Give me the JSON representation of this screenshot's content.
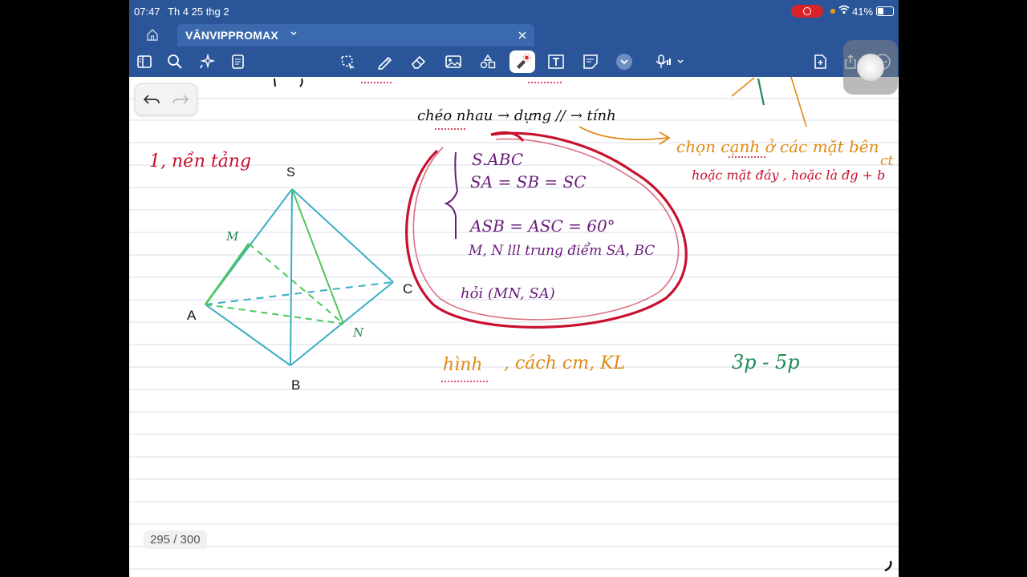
{
  "status_bar": {
    "time": "07:47",
    "date": "Th 4 25 thg 2",
    "battery": "41%"
  },
  "tab": {
    "title": "VÂNVIPPROMAX"
  },
  "page_indicator": "295 / 300",
  "notes": {
    "line_cheo": "chéo nhau → dựng // → tính",
    "chon_canh": "chọn cạnh ở các mặt bên",
    "hoac_mat": "hoặc mặt đáy , hoặc là đg + b",
    "ct": "ct",
    "nen_tang": "1, nền tảng",
    "s_abc": "S.ABC",
    "sa_sb_sc": "SA = SB = SC",
    "angles": "ASB = ASC = 60°",
    "mn": "M, N lll trung điểm SA, BC",
    "hoi": "hỏi (MN, SA)",
    "hinh": "hình",
    "cach_cm": ", cách cm, KL",
    "time_est": "3p - 5p",
    "label_S": "S",
    "label_A": "A",
    "label_B": "B",
    "label_C": "C",
    "label_M": "M",
    "label_N": "N"
  },
  "colors": {
    "brand": "#2a5699",
    "tab": "#3b69ad",
    "pen_red": "#c8102e",
    "pen_purple": "#6a1b7a",
    "pen_orange": "#e08a12",
    "pen_green": "#1f8a52",
    "pen_teal": "#3aaec4",
    "pen_lime": "#4cc75a"
  },
  "icons": [
    "home-icon",
    "sidebar-icon",
    "search-icon",
    "sparkle-icon",
    "page-list-icon",
    "lasso-icon",
    "pen-icon",
    "eraser-icon",
    "image-icon",
    "shapes-icon",
    "laser-pointer-icon",
    "text-box-icon",
    "sticky-note-icon",
    "chevron-down-icon",
    "microphone-icon",
    "add-page-icon",
    "share-icon",
    "more-icon",
    "undo-icon",
    "redo-icon"
  ]
}
